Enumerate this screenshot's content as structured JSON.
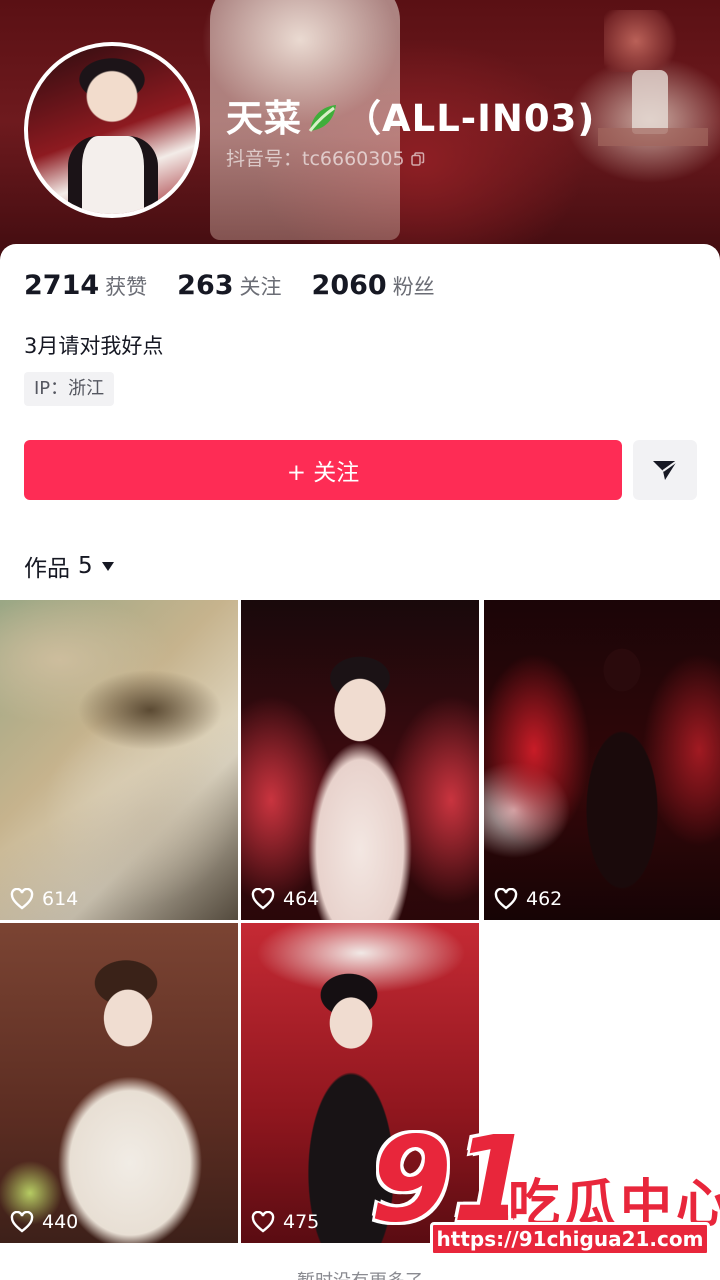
{
  "profile": {
    "nickname": "天菜",
    "nickname_suffix": "（ALL-IN03)",
    "leaf_icon": "bok-choy-emoji",
    "douyin_id_label": "抖音号：",
    "douyin_id": "tc6660305",
    "bio": "3月请对我好点",
    "ip": "IP：浙江"
  },
  "stats": [
    {
      "value": "2714",
      "label": "获赞"
    },
    {
      "value": "263",
      "label": "关注"
    },
    {
      "value": "2060",
      "label": "粉丝"
    }
  ],
  "actions": {
    "follow_label": "+ 关注",
    "share_icon": "send-icon"
  },
  "works": {
    "tab_label": "作品",
    "count": "5",
    "items": [
      {
        "likes": "614"
      },
      {
        "likes": "464"
      },
      {
        "likes": "462"
      },
      {
        "likes": "440"
      },
      {
        "likes": "475"
      }
    ],
    "no_more": "暂时没有更多了"
  },
  "watermark": {
    "number": "91",
    "text": "吃瓜中心",
    "url": "https://91chigua21.com"
  },
  "colors": {
    "accent": "#fe2c55",
    "watermark": "#e8263b"
  }
}
